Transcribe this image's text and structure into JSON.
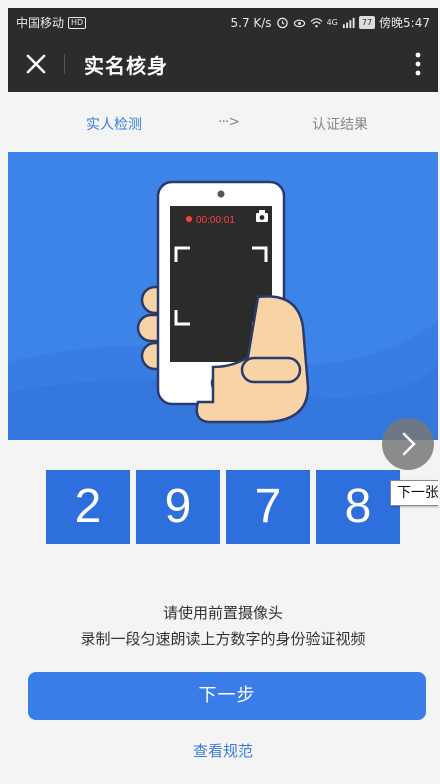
{
  "status_bar": {
    "carrier": "中国移动",
    "hd_badge": "HD",
    "net_speed": "5.7 K/s",
    "signal_label": "4G",
    "battery": "77",
    "time": "傍晚5:47"
  },
  "header": {
    "title": "实名核身"
  },
  "steps": {
    "step1": "实人检测",
    "arrow": "···>",
    "step2": "认证结果"
  },
  "hero": {
    "record_time": "00:00:01"
  },
  "digits": [
    "2",
    "9",
    "7",
    "8"
  ],
  "tooltip": "下一张",
  "instructions": {
    "line1": "请使用前置摄像头",
    "line2": "录制一段匀速朗读上方数字的身份验证视频"
  },
  "buttons": {
    "next": "下一步",
    "view_rules": "查看规范"
  },
  "colors": {
    "header_bg": "#2b2c2e",
    "accent": "#3a7de8",
    "hero_bg": "#3d84e8",
    "digit_bg": "#2e6fde",
    "record_red": "#ff4040"
  }
}
